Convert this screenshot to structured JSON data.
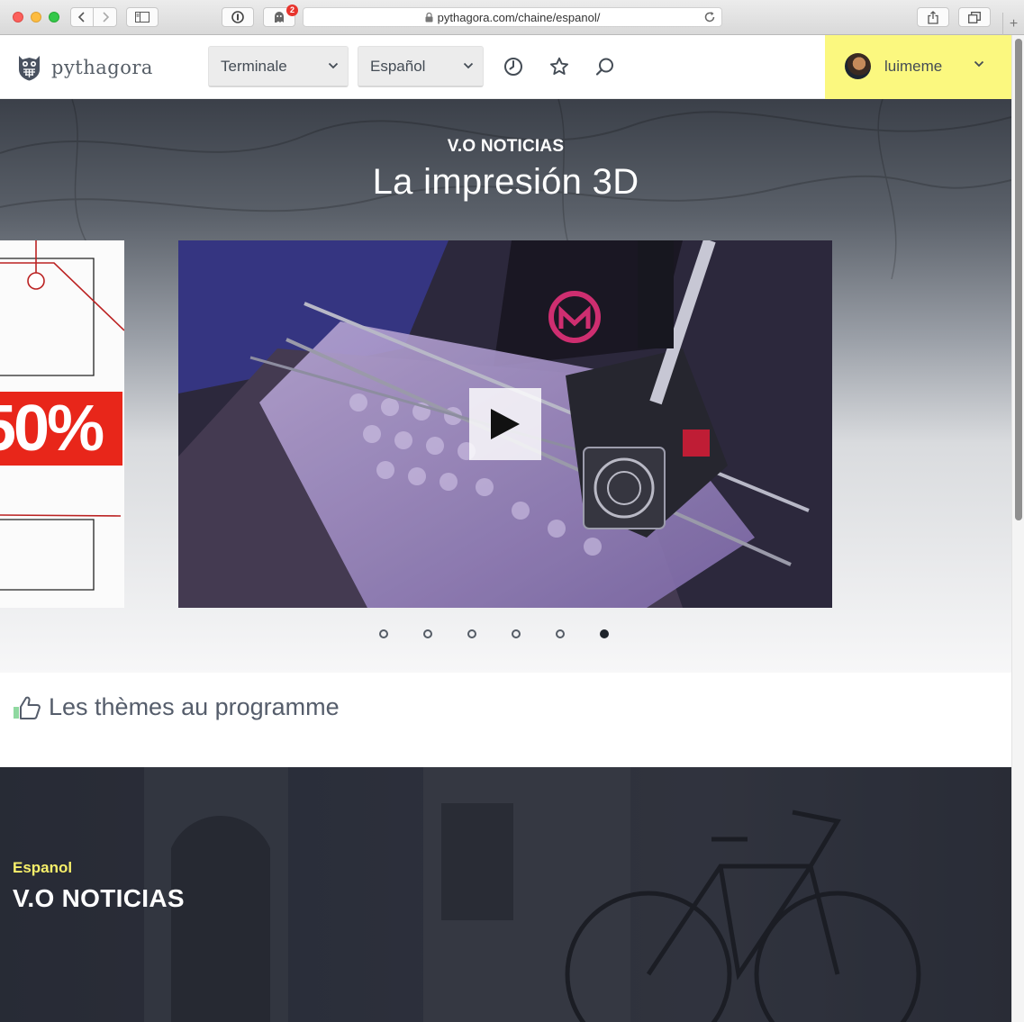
{
  "browser": {
    "url": "pythagora.com/chaine/espanol/",
    "notification_count": "2"
  },
  "header": {
    "logo_text": "pythagora",
    "level_select": "Terminale",
    "language_select": "Español",
    "username": "luimeme"
  },
  "hero": {
    "kicker": "V.O NOTICIAS",
    "title": "La impresión 3D",
    "prev_slide_text": "50%",
    "slide_count": 6,
    "active_slide": 6
  },
  "themes": {
    "title": "Les thèmes au programme"
  },
  "channel": {
    "kicker": "Espanol",
    "title": "V.O NOTICIAS"
  },
  "colors": {
    "accent_yellow": "#fbf87f",
    "channel_kicker": "#f7ef6a",
    "promo_red": "#e8261a"
  }
}
